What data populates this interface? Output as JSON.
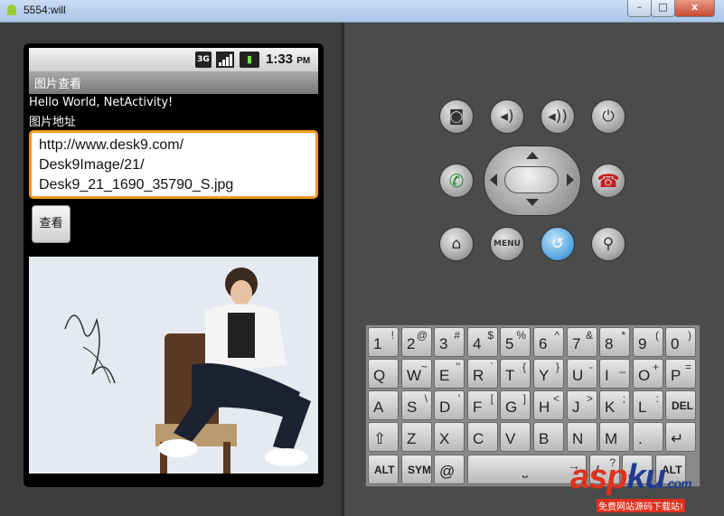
{
  "window": {
    "title": "5554:will",
    "buttons": {
      "minimize": "–",
      "maximize": "□",
      "close": "x"
    }
  },
  "status_bar": {
    "network": "3G",
    "time": "1:33",
    "ampm": "PM"
  },
  "app": {
    "title": "图片查看",
    "hello_text": "Hello World, NetActivity!",
    "url_label": "图片地址",
    "url_value_lines": [
      "http://www.desk9.com/",
      "Desk9Image/21/",
      "Desk9_21_1690_35790_S.jpg"
    ],
    "view_button": "查看"
  },
  "controls": {
    "top_row": [
      "camera-icon",
      "volume-down-icon",
      "volume-up-icon",
      "power-icon"
    ],
    "call": "call-icon",
    "end": "end-call-icon",
    "bottom_row": [
      "home-icon",
      "MENU",
      "back-icon",
      "search-icon"
    ]
  },
  "keyboard": {
    "rows": [
      [
        [
          "1",
          "!"
        ],
        [
          "2",
          "@"
        ],
        [
          "3",
          "#"
        ],
        [
          "4",
          "$"
        ],
        [
          "5",
          "%"
        ],
        [
          "6",
          "^"
        ],
        [
          "7",
          "&"
        ],
        [
          "8",
          "*"
        ],
        [
          "9",
          "("
        ],
        [
          "0",
          ")"
        ]
      ],
      [
        [
          "Q",
          ""
        ],
        [
          "W",
          "~"
        ],
        [
          "E",
          "\""
        ],
        [
          "R",
          "`"
        ],
        [
          "T",
          "{"
        ],
        [
          "Y",
          "}"
        ],
        [
          "U",
          "-"
        ],
        [
          "I",
          "_"
        ],
        [
          "O",
          "+"
        ],
        [
          "P",
          "="
        ]
      ],
      [
        [
          "A",
          ""
        ],
        [
          "S",
          "\\"
        ],
        [
          "D",
          "'"
        ],
        [
          "F",
          "["
        ],
        [
          "G",
          "]"
        ],
        [
          "H",
          "<"
        ],
        [
          "J",
          ">"
        ],
        [
          "K",
          ";"
        ],
        [
          "L",
          ":"
        ],
        [
          "DEL",
          ""
        ]
      ],
      [
        [
          "⇧",
          ""
        ],
        [
          "Z",
          ""
        ],
        [
          "X",
          ""
        ],
        [
          "C",
          ""
        ],
        [
          "V",
          ""
        ],
        [
          "B",
          ""
        ],
        [
          "N",
          ""
        ],
        [
          "M",
          ""
        ],
        [
          ".",
          ""
        ],
        [
          "↵",
          ""
        ]
      ],
      [
        [
          "ALT",
          ""
        ],
        [
          "SYM",
          ""
        ],
        [
          "@",
          ""
        ],
        [
          "⎵",
          "→"
        ],
        [
          "/",
          "?"
        ],
        [
          ",",
          ""
        ],
        [
          "ALT",
          ""
        ]
      ]
    ]
  },
  "watermark": {
    "text_a": "asp",
    "text_b": "ku",
    "text_c": ".com",
    "sub": "免费网站源码下载站!"
  }
}
